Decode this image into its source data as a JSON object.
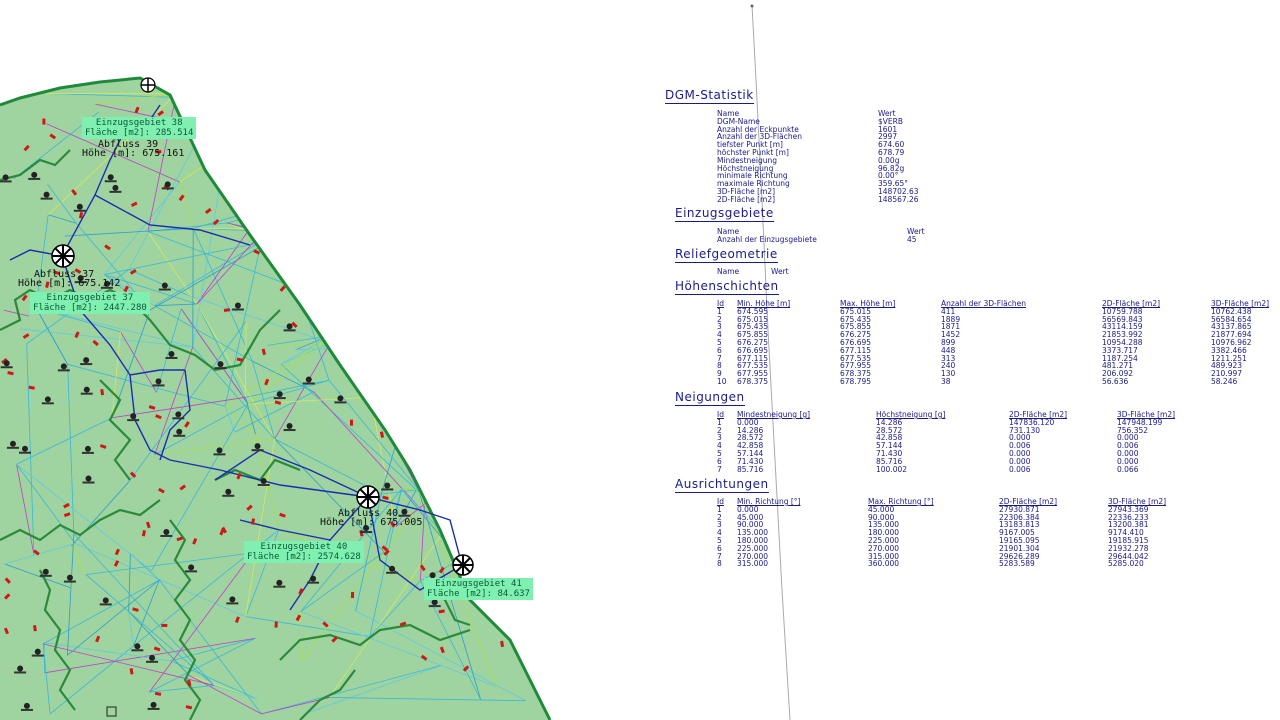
{
  "map": {
    "labels": [
      {
        "title": "Einzugsgebiet 38",
        "area": "Fläche [m2]: 285.514"
      },
      {
        "title": "Einzugsgebiet 37",
        "area": "Fläche [m2]: 2447.280"
      },
      {
        "title": "Einzugsgebiet 40",
        "area": "Fläche [m2]: 2574.628"
      },
      {
        "title": "Einzugsgebiet 41",
        "area": "Fläche [m2]: 84.637"
      }
    ],
    "outlets": [
      {
        "name": "Abfluss 39",
        "height": "Höhe [m]: 675.161"
      },
      {
        "name": "Abfluss 37",
        "height": "Höhe [m]: 675.142"
      },
      {
        "name": "Abfluss 40",
        "height": "Höhe [m]: 675.005"
      }
    ],
    "colors": {
      "fill": "#9fd3a0",
      "boundary": "#1f8a3a",
      "flow": "#1a2db0",
      "triangulation_cyan": "#39b8d8",
      "triangulation_magenta": "#c040c8",
      "triangulation_yellow": "#d8e85a",
      "markers": "#d01818"
    }
  },
  "stats": {
    "title": "DGM-Statistik",
    "dgm": {
      "col1": "Name",
      "col2": "Wert",
      "rows": [
        [
          "DGM-Name",
          "$VERB"
        ],
        [
          "Anzahl der Eckpunkte",
          "1601"
        ],
        [
          "Anzahl der 3D-Flächen",
          "2997"
        ],
        [
          "tiefster Punkt [m]",
          "674.60"
        ],
        [
          "höchster Punkt [m]",
          "678.79"
        ],
        [
          "Mindestneigung",
          "0.00g"
        ],
        [
          "Höchstneigung",
          "96.82g"
        ],
        [
          "minimale Richtung",
          "0.00°"
        ],
        [
          "maximale Richtung",
          "359.65°"
        ],
        [
          "3D-Fläche [m2]",
          "148702.63"
        ],
        [
          "2D-Fläche [m2]",
          "148567.26"
        ]
      ]
    },
    "einzugsgebiete": {
      "title": "Einzugsgebiete",
      "col1": "Name",
      "col2": "Wert",
      "rows": [
        [
          "Anzahl der Einzugsgebiete",
          "45"
        ]
      ]
    },
    "relief": {
      "title": "Reliefgeometrie",
      "col1": "Name",
      "col2": "Wert"
    },
    "hoehenschichten": {
      "title": "Höhenschichten",
      "headers": [
        "Id",
        "Min. Höhe [m]",
        "Max. Höhe [m]",
        "Anzahl der 3D-Flächen",
        "2D-Fläche [m2]",
        "3D-Fläche [m2]"
      ],
      "rows": [
        [
          "1",
          "674.595",
          "675.015",
          "411",
          "10759.788",
          "10762.438"
        ],
        [
          "2",
          "675.015",
          "675.435",
          "1889",
          "56569.843",
          "56584.654"
        ],
        [
          "3",
          "675.435",
          "675.855",
          "1871",
          "43114.159",
          "43137.865"
        ],
        [
          "4",
          "675.855",
          "676.275",
          "1452",
          "21853.992",
          "21877.694"
        ],
        [
          "5",
          "676.275",
          "676.695",
          "899",
          "10954.288",
          "10976.962"
        ],
        [
          "6",
          "676.695",
          "677.115",
          "448",
          "3373.717",
          "3382.466"
        ],
        [
          "7",
          "677.115",
          "677.535",
          "313",
          "1187.254",
          "1211.251"
        ],
        [
          "8",
          "677.535",
          "677.955",
          "240",
          "481.271",
          "489.923"
        ],
        [
          "9",
          "677.955",
          "678.375",
          "130",
          "206.092",
          "210.997"
        ],
        [
          "10",
          "678.375",
          "678.795",
          "38",
          "56.636",
          "58.246"
        ]
      ]
    },
    "neigungen": {
      "title": "Neigungen",
      "headers": [
        "Id",
        "Mindestneigung [g]",
        "Höchstneigung [g]",
        "2D-Fläche [m2]",
        "3D-Fläche [m2]"
      ],
      "rows": [
        [
          "1",
          "0.000",
          "14.286",
          "147836.120",
          "147948.199"
        ],
        [
          "2",
          "14.286",
          "28.572",
          "731.130",
          "756.352"
        ],
        [
          "3",
          "28.572",
          "42.858",
          "0.000",
          "0.000"
        ],
        [
          "4",
          "42.858",
          "57.144",
          "0.006",
          "0.006"
        ],
        [
          "5",
          "57.144",
          "71.430",
          "0.000",
          "0.000"
        ],
        [
          "6",
          "71.430",
          "85.716",
          "0.000",
          "0.000"
        ],
        [
          "7",
          "85.716",
          "100.002",
          "0.006",
          "0.066"
        ]
      ]
    },
    "ausrichtungen": {
      "title": "Ausrichtungen",
      "headers": [
        "Id",
        "Min. Richtung [°]",
        "Max. Richtung [°]",
        "2D-Fläche [m2]",
        "3D-Fläche [m2]"
      ],
      "rows": [
        [
          "1",
          "0.000",
          "45.000",
          "27930.871",
          "27943.369"
        ],
        [
          "2",
          "45.000",
          "90.000",
          "22306.384",
          "22336.233"
        ],
        [
          "3",
          "90.000",
          "135.000",
          "13183.813",
          "13200.381"
        ],
        [
          "4",
          "135.000",
          "180.000",
          "9167.005",
          "9174.410"
        ],
        [
          "5",
          "180.000",
          "225.000",
          "19165.095",
          "19185.915"
        ],
        [
          "6",
          "225.000",
          "270.000",
          "21901.304",
          "21932.278"
        ],
        [
          "7",
          "270.000",
          "315.000",
          "29626.289",
          "29644.042"
        ],
        [
          "8",
          "315.000",
          "360.000",
          "5283.589",
          "5285.020"
        ]
      ]
    }
  }
}
